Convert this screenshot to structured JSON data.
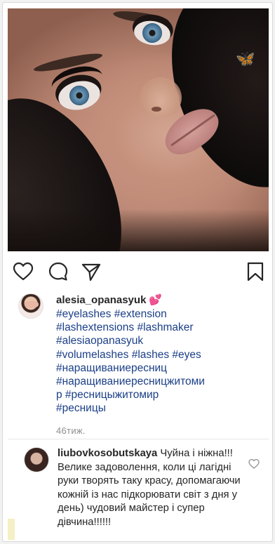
{
  "post": {
    "author": "alesia_opanasyuk",
    "author_emoji": "💕",
    "caption_tags": "#eyelashes #extension\n#lashextensions #lashmaker\n#alesiaopanasyuk\n#volumelashes #lashes #eyes\n#наращиваниересниц\n#наращиваниересницжитоми\nр #ресницыжитомир\n#ресницы",
    "time_ago": "46тиж."
  },
  "actions": {
    "like_icon": "heart-outline-icon",
    "comment_icon": "speech-bubble-icon",
    "share_icon": "paper-plane-icon",
    "save_icon": "bookmark-icon"
  },
  "comment": {
    "username": "liubovkosobutskaya",
    "text": " Чуйна і ніжна!!! Велике задоволення, коли ці лагідні руки творять таку красу, допомагаючи кожній із нас підкорювати світ з дня у день) чудовий майстер і супер дівчина!!!!!!"
  },
  "colors": {
    "hashtag": "#1b3f87",
    "text": "#262626",
    "muted": "#8e8e8e",
    "emoji_pink": "#ff4fa0"
  }
}
